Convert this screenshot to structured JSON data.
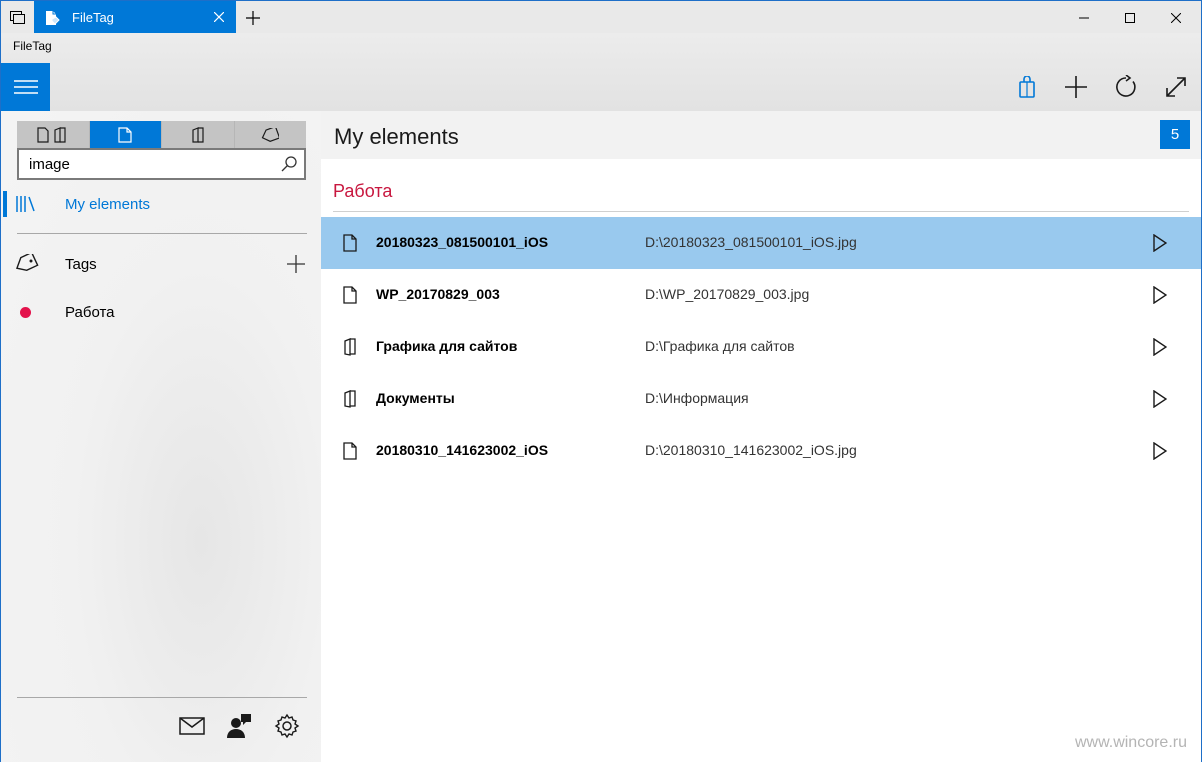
{
  "titlebar": {
    "tab_title": "FileTag"
  },
  "appbar": {
    "app_title": "FileTag"
  },
  "sidebar": {
    "search": {
      "value": "image",
      "placeholder": ""
    },
    "nav": {
      "my_elements": "My elements",
      "tags": "Tags",
      "tag_items": [
        {
          "label": "Работа",
          "color": "#e3124b"
        }
      ]
    }
  },
  "main": {
    "title": "My elements",
    "count": "5",
    "group": {
      "title": "Работа",
      "items": [
        {
          "name": "20180323_081500101_iOS",
          "path": "D:\\20180323_081500101_iOS.jpg",
          "kind": "file-icon",
          "selected": true
        },
        {
          "name": "WP_20170829_003",
          "path": "D:\\WP_20170829_003.jpg",
          "kind": "file-icon",
          "selected": false
        },
        {
          "name": "Графика для сайтов",
          "path": "D:\\Графика для сайтов",
          "kind": "folder-icon",
          "selected": false
        },
        {
          "name": "Документы",
          "path": "D:\\Информация",
          "kind": "folder-icon",
          "selected": false
        },
        {
          "name": "20180310_141623002_iOS",
          "path": "D:\\20180310_141623002_iOS.jpg",
          "kind": "file-icon",
          "selected": false
        }
      ]
    }
  },
  "watermark": "www.wincore.ru",
  "colors": {
    "accent": "#0078d7",
    "selection": "#99c9ee",
    "group": "#c8173f",
    "tag": "#e3124b"
  }
}
